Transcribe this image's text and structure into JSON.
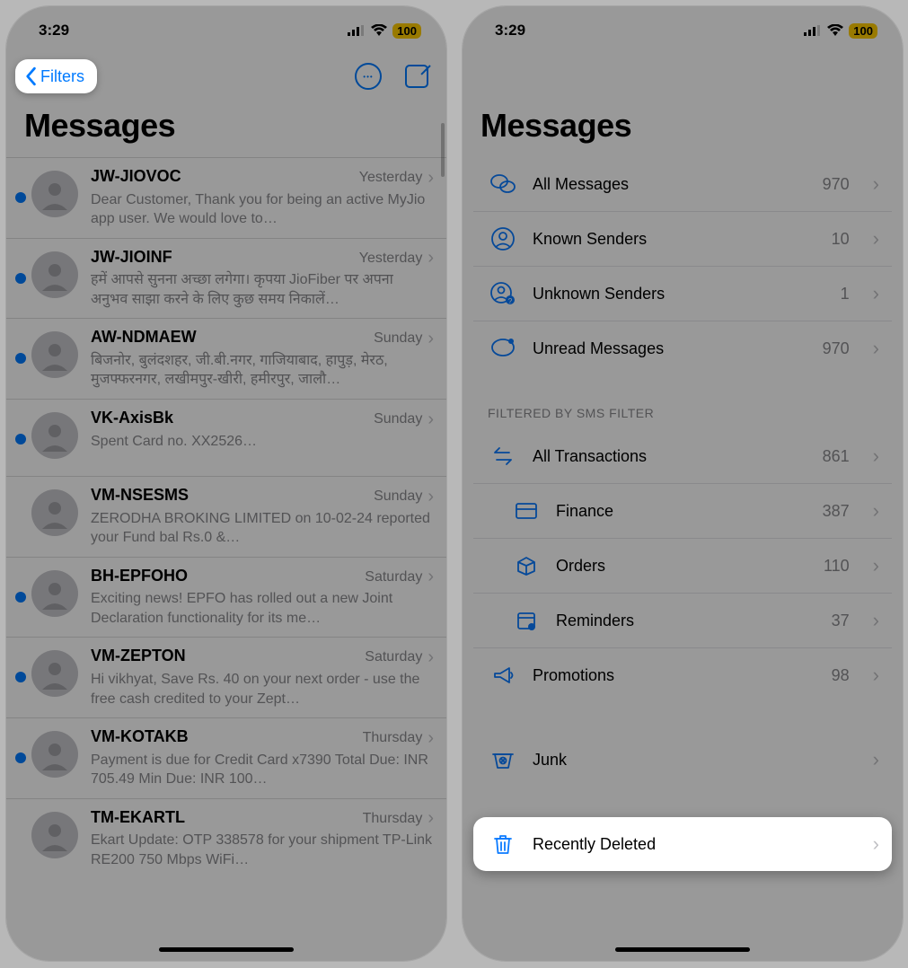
{
  "statusBar": {
    "time": "3:29",
    "battery": "100"
  },
  "left": {
    "navBack": "Filters",
    "title": "Messages",
    "conversations": [
      {
        "sender": "JW-JIOVOC",
        "time": "Yesterday",
        "preview": "Dear Customer, Thank you for being an active MyJio app user. We would love to…",
        "unread": true
      },
      {
        "sender": "JW-JIOINF",
        "time": "Yesterday",
        "preview": "हमें आपसे सुनना अच्छा लगेगा। कृपया JioFiber पर अपना अनुभव साझा करने के लिए कुछ समय निकालें…",
        "unread": true
      },
      {
        "sender": "AW-NDMAEW",
        "time": "Sunday",
        "preview": "बिजनोर, बुलंदशहर, जी.बी.नगर, गाजियाबाद, हापुड़, मेरठ, मुजफ्फरनगर, लखीमपुर-खीरी, हमीरपुर, जालौ…",
        "unread": true
      },
      {
        "sender": "VK-AxisBk",
        "time": "Sunday",
        "preview": "Spent\nCard no. XX2526…",
        "unread": true
      },
      {
        "sender": "VM-NSESMS",
        "time": "Sunday",
        "preview": "ZERODHA BROKING LIMITED on 10-02-24 reported your Fund bal Rs.0 &…",
        "unread": false
      },
      {
        "sender": "BH-EPFOHO",
        "time": "Saturday",
        "preview": "Exciting news! EPFO has rolled out a new Joint Declaration functionality for its me…",
        "unread": true
      },
      {
        "sender": "VM-ZEPTON",
        "time": "Saturday",
        "preview": "Hi vikhyat, Save Rs. 40 on your next order - use the free cash credited to your Zept…",
        "unread": true
      },
      {
        "sender": "VM-KOTAKB",
        "time": "Thursday",
        "preview": "Payment is due for Credit Card x7390 Total Due: INR 705.49 Min Due: INR 100…",
        "unread": true
      },
      {
        "sender": "TM-EKARTL",
        "time": "Thursday",
        "preview": "Ekart Update: OTP 338578 for your shipment TP-Link RE200 750 Mbps WiFi…",
        "unread": false
      }
    ]
  },
  "right": {
    "title": "Messages",
    "groupA": [
      {
        "icon": "bubbles",
        "label": "All Messages",
        "count": "970"
      },
      {
        "icon": "person",
        "label": "Known Senders",
        "count": "10"
      },
      {
        "icon": "person-q",
        "label": "Unknown Senders",
        "count": "1"
      },
      {
        "icon": "bubble-dot",
        "label": "Unread Messages",
        "count": "970"
      }
    ],
    "filteredHeader": "Filtered by SMS Filter",
    "groupB": [
      {
        "icon": "transfer",
        "label": "All Transactions",
        "count": "861",
        "indent": false
      },
      {
        "icon": "card",
        "label": "Finance",
        "count": "387",
        "indent": true
      },
      {
        "icon": "box",
        "label": "Orders",
        "count": "110",
        "indent": true
      },
      {
        "icon": "calendar",
        "label": "Reminders",
        "count": "37",
        "indent": true
      },
      {
        "icon": "megaphone",
        "label": "Promotions",
        "count": "98",
        "indent": false
      }
    ],
    "junk": {
      "icon": "junk",
      "label": "Junk",
      "count": ""
    },
    "recentlyDeleted": {
      "icon": "trash",
      "label": "Recently Deleted",
      "count": ""
    }
  }
}
